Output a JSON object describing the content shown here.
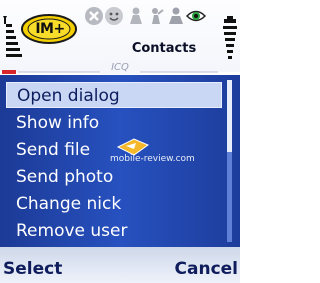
{
  "app": {
    "logo_text": "IM+",
    "title": "Contacts",
    "tab_label": "ICQ"
  },
  "status_icons": [
    "close-icon",
    "smiley-status-icon",
    "person-status-icon",
    "person-away-icon",
    "person-busy-icon",
    "eye-visible-icon"
  ],
  "menu": {
    "items": [
      {
        "label": "Open dialog",
        "selected": true
      },
      {
        "label": "Show info"
      },
      {
        "label": "Send file"
      },
      {
        "label": "Send photo"
      },
      {
        "label": "Change nick"
      },
      {
        "label": "Remove user"
      }
    ]
  },
  "watermark": {
    "text": "mobile-review.com"
  },
  "softkeys": {
    "left": "Select",
    "right": "Cancel"
  },
  "colors": {
    "menu_background": "#2751bf",
    "selection": "#c9d6f4",
    "softkey_text": "#0f1d5c",
    "logo_yellow": "#f5d000"
  }
}
